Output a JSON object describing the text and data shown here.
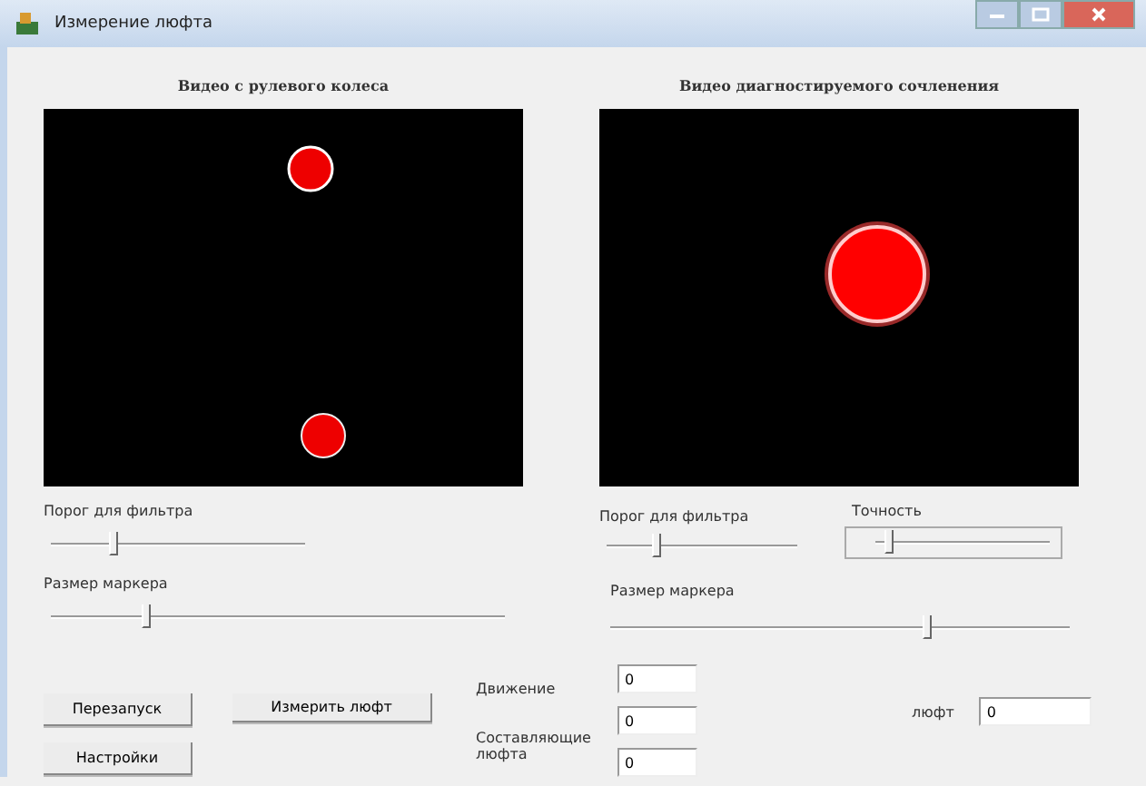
{
  "window": {
    "title": "Измерение люфта"
  },
  "left_panel": {
    "title": "Видео с рулевого колеса",
    "sliders": [
      {
        "label": "Порог для фильтра",
        "level": 0.23
      },
      {
        "label": "Размер маркера",
        "level": 0.2
      }
    ]
  },
  "right_panel": {
    "title": "Видео диагностируемого сочленения",
    "filter_slider": {
      "label": "Порог для фильтра",
      "level": 0.24
    },
    "precision_slider": {
      "label": "Точность",
      "level": 0.05
    },
    "marker_slider": {
      "label": "Размер маркера",
      "level": 0.68
    }
  },
  "buttons": [
    {
      "label": "Перезапуск"
    },
    {
      "label": "Измерить люфт"
    },
    {
      "label": "Настройки"
    }
  ],
  "fields": [
    {
      "label": "Движение",
      "value": "0"
    },
    {
      "label": "Составляющие люфта",
      "value": "0"
    },
    {
      "value": "0"
    }
  ],
  "backlash": {
    "label": "люфт",
    "value": "0"
  }
}
